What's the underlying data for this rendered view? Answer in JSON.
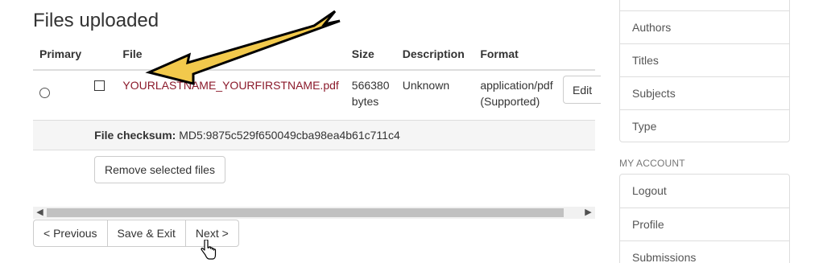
{
  "files_section": {
    "title": "Files uploaded",
    "columns": {
      "primary": "Primary",
      "file": "File",
      "size": "Size",
      "description": "Description",
      "format": "Format"
    },
    "file": {
      "name": "YOURLASTNAME_YOURFIRSTNAME.pdf",
      "size_line1": "566380",
      "size_line2": "bytes",
      "description": "Unknown",
      "format_line1": "application/pdf",
      "format_line2": "(Supported)",
      "edit_label": "Edit"
    },
    "checksum": {
      "label": "File checksum:",
      "value": "MD5:9875c529f650049cba98ea4b61c711c4"
    },
    "remove_label": "Remove selected files"
  },
  "navigation": {
    "previous_label": "< Previous",
    "save_exit_label": "Save & Exit",
    "next_label": "Next >"
  },
  "sidebar": {
    "browse_items": [
      "Authors",
      "Titles",
      "Subjects",
      "Type"
    ],
    "account_heading": "MY ACCOUNT",
    "account_items": [
      "Logout",
      "Profile",
      "Submissions"
    ]
  },
  "colors": {
    "file_link": "#8b1a2b",
    "annotation_arrow_fill": "#f2c94c",
    "annotation_arrow_stroke": "#000000"
  },
  "icons": {
    "annotation": "arrow-pointer-icon",
    "cursor": "hand-cursor-icon"
  }
}
